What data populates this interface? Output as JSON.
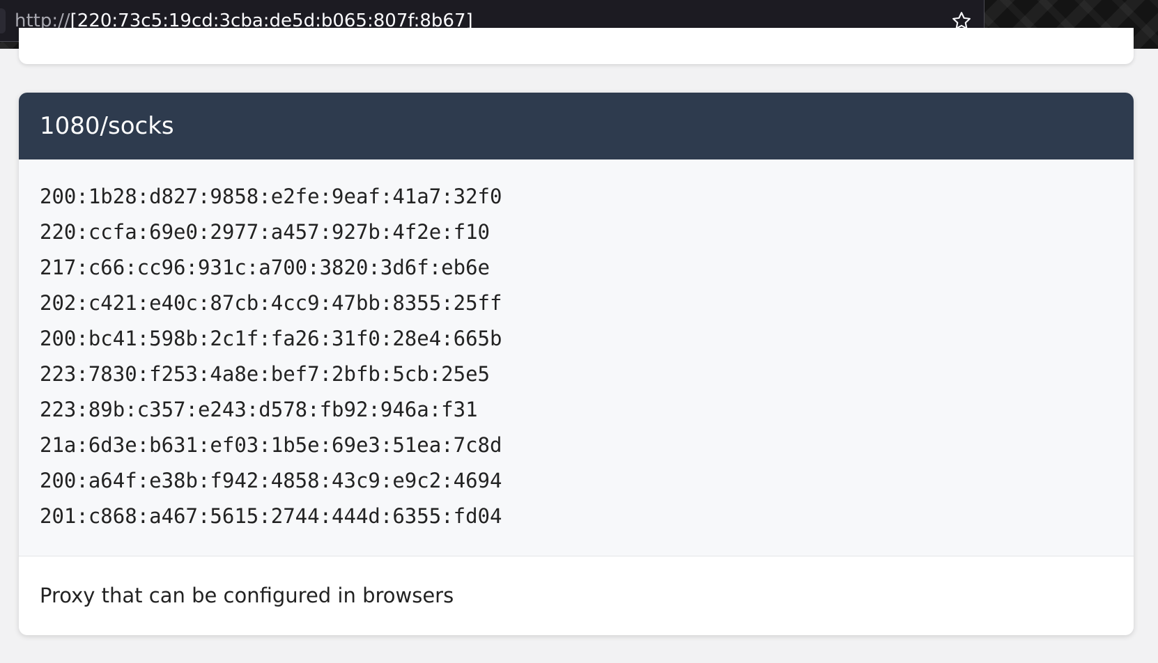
{
  "browser": {
    "url_scheme": "http://",
    "url_host": "[220:73c5:19cd:3cba:de5d:b065:807f:8b67]",
    "bookmark_icon": "star-icon"
  },
  "service": {
    "title": "1080/socks",
    "addresses": [
      "200:1b28:d827:9858:e2fe:9eaf:41a7:32f0",
      "220:ccfa:69e0:2977:a457:927b:4f2e:f10",
      "217:c66:cc96:931c:a700:3820:3d6f:eb6e",
      "202:c421:e40c:87cb:4cc9:47bb:8355:25ff",
      "200:bc41:598b:2c1f:fa26:31f0:28e4:665b",
      "223:7830:f253:4a8e:bef7:2bfb:5cb:25e5",
      "223:89b:c357:e243:d578:fb92:946a:f31",
      "21a:6d3e:b631:ef03:1b5e:69e3:51ea:7c8d",
      "200:a64f:e38b:f942:4858:43c9:e9c2:4694",
      "201:c868:a467:5615:2744:444d:6355:fd04"
    ],
    "description": "Proxy that can be configured in browsers"
  },
  "colors": {
    "header_bg": "#2e3b4e",
    "body_bg": "#f7f8fa",
    "page_bg": "#f2f2f3"
  }
}
